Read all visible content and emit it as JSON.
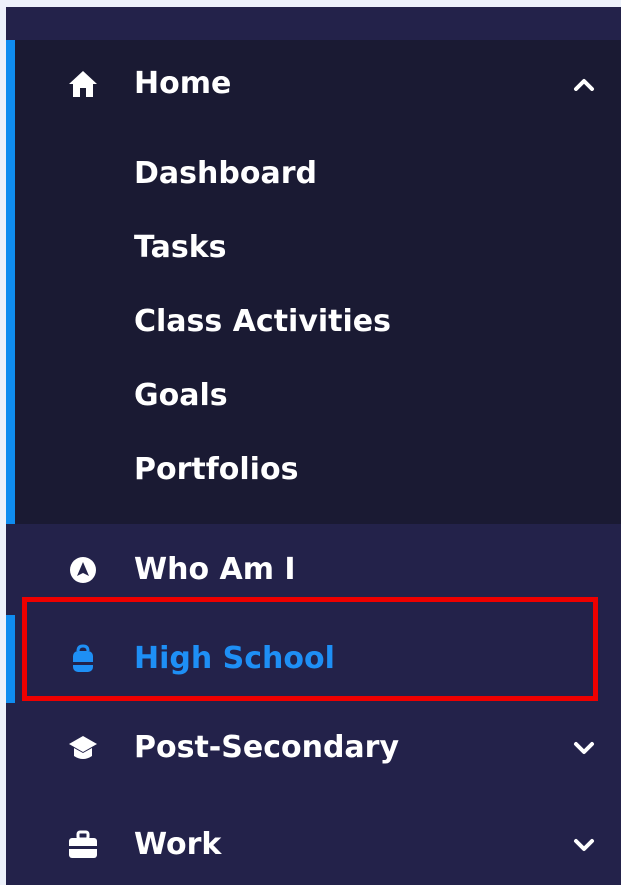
{
  "sidebar": {
    "home": {
      "label": "Home",
      "expanded": true,
      "submenu": [
        "Dashboard",
        "Tasks",
        "Class Activities",
        "Goals",
        "Portfolios"
      ]
    },
    "items": [
      {
        "label": "Who Am I",
        "icon": "compass-icon",
        "active": false,
        "has_chevron": false
      },
      {
        "label": "High School",
        "icon": "backpack-icon",
        "active": true,
        "has_chevron": false
      },
      {
        "label": "Post-Secondary",
        "icon": "graduation-cap-icon",
        "active": false,
        "has_chevron": true
      },
      {
        "label": "Work",
        "icon": "briefcase-icon",
        "active": false,
        "has_chevron": true
      }
    ]
  },
  "colors": {
    "page_background": "#edf1fa",
    "sidebar_background": "#23224a",
    "expanded_background": "#1a1a33",
    "accent": "#0f8cf0",
    "active_text": "#1e8ff5",
    "text": "#ffffff",
    "highlight_border": "#ee0000"
  }
}
